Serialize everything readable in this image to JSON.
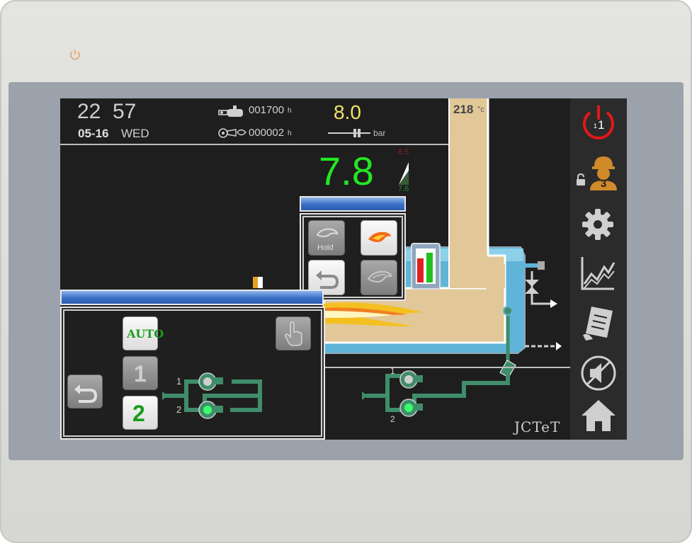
{
  "status": {
    "time_hour": "22",
    "time_min": "57",
    "date": "05-16",
    "weekday": "WED",
    "burner_hours": "001700",
    "burner_hours_unit": "h",
    "fan_hours": "000002",
    "fan_hours_unit": "h",
    "setpoint": "8.0",
    "setpoint_unit": "bar",
    "stack_temp": "218",
    "stack_temp_unit": "°c"
  },
  "pressure": {
    "value": "7.8",
    "upper_limit": "8.5",
    "lower_limit": "7.6"
  },
  "burner_popup": {
    "hold_label": "Hold",
    "buttons": [
      "hold-button",
      "flame-button",
      "back-button",
      "flame-off-button"
    ]
  },
  "pump_popup": {
    "auto_label": "AUTO",
    "pump1_label": "1",
    "pump2_label": "2",
    "line1": "1",
    "line2": "2"
  },
  "schematic": {
    "pump_line1": "1",
    "pump_line2": "2",
    "brand": "JCTeT"
  },
  "sidebar": {
    "power_badge_small": "1",
    "power_badge_large": "1",
    "user_level": "3"
  },
  "colors": {
    "pressure_green": "#22e822",
    "setpoint_yellow": "#f4e36a",
    "stack_tan": "#e2c898",
    "pipe_green": "#3f8d6a",
    "water_blue": "#5fb4d8",
    "power_red": "#e01818"
  }
}
